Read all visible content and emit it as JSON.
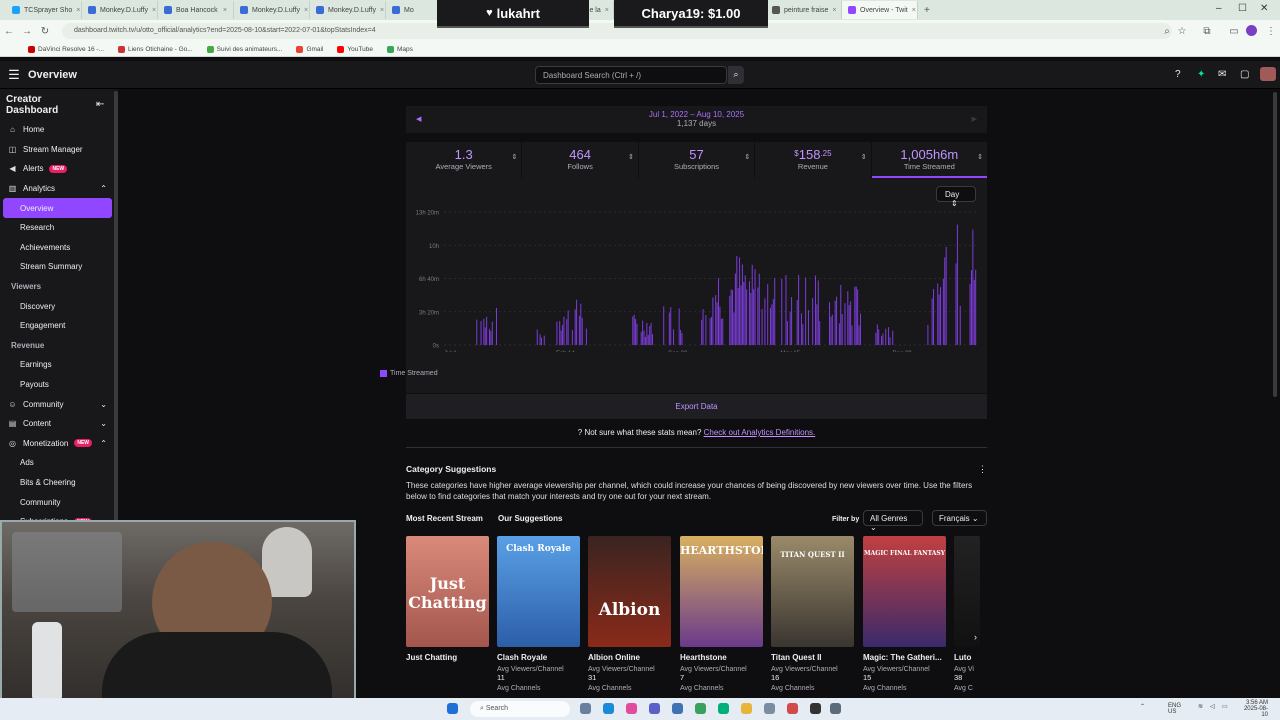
{
  "browser": {
    "tabs": [
      "TCSprayer Sho",
      "Monkey.D.Luffy",
      "Boa Hancock",
      "Monkey.D.Luffy",
      "Monkey.D.Luffy",
      "Mo",
      "Canada",
      "Customs de la",
      "Redimensionn",
      "Search Results",
      "peinture fraise",
      "Overview - Twit"
    ],
    "url": "dashboard.twitch.tv/u/otto_official/analytics?end=2025-08-10&start=2022-07-01&topStatsIndex=4",
    "bookmarks": [
      "DaVinci Resolve 16 -...",
      "Liens Otichaine - Go...",
      "Suivi des animateurs...",
      "Gmail",
      "YouTube",
      "Maps"
    ]
  },
  "overlays": {
    "left": "lukahrt",
    "right": "Charya19: $1.00"
  },
  "topnav": {
    "title": "Overview",
    "search_placeholder": "Dashboard Search (Ctrl + /)"
  },
  "sidebar": {
    "header": "Creator Dashboard",
    "items": [
      {
        "label": "Home",
        "icon": "home-icon",
        "type": "top"
      },
      {
        "label": "Stream Manager",
        "icon": "stream-manager-icon",
        "type": "top"
      },
      {
        "label": "Alerts",
        "icon": "alerts-icon",
        "type": "top",
        "badge": "NEW"
      },
      {
        "label": "Analytics",
        "icon": "analytics-icon",
        "type": "top",
        "chev": "up"
      },
      {
        "label": "Overview",
        "type": "sub",
        "active": true
      },
      {
        "label": "Research",
        "type": "sub"
      },
      {
        "label": "Achievements",
        "type": "sub"
      },
      {
        "label": "Stream Summary",
        "type": "sub"
      },
      {
        "label": "Viewers",
        "type": "cat"
      },
      {
        "label": "Discovery",
        "type": "sub"
      },
      {
        "label": "Engagement",
        "type": "sub"
      },
      {
        "label": "Revenue",
        "type": "cat"
      },
      {
        "label": "Earnings",
        "type": "sub"
      },
      {
        "label": "Payouts",
        "type": "sub"
      },
      {
        "label": "Community",
        "icon": "community-icon",
        "type": "top",
        "chev": "down"
      },
      {
        "label": "Content",
        "icon": "content-icon",
        "type": "top",
        "chev": "down"
      },
      {
        "label": "Monetization",
        "icon": "monetization-icon",
        "type": "top",
        "badge": "NEW",
        "chev": "up"
      },
      {
        "label": "Ads",
        "type": "sub"
      },
      {
        "label": "Bits & Cheering",
        "type": "sub"
      },
      {
        "label": "Community",
        "type": "sub"
      },
      {
        "label": "Subscriptions",
        "type": "sub",
        "badge": "NEW"
      }
    ]
  },
  "daterange": {
    "range": "Jul 1, 2022 – Aug 10, 2025",
    "days": "1,137 days"
  },
  "stats": [
    {
      "value": "1.3",
      "label": "Average Viewers"
    },
    {
      "value": "464",
      "label": "Follows"
    },
    {
      "value": "57",
      "label": "Subscriptions"
    },
    {
      "value_prefix": "$",
      "value": "158",
      "value_suffix": ".25",
      "label": "Revenue"
    },
    {
      "value": "1,005h6m",
      "label": "Time Streamed",
      "active": true
    }
  ],
  "chart_controls": {
    "granularity": "Day"
  },
  "chart_data": {
    "type": "bar",
    "title": "",
    "series": [
      {
        "name": "Time Streamed"
      }
    ],
    "y_ticks": [
      "13h 20m",
      "10h",
      "6h 40m",
      "3h 20m",
      "0s"
    ],
    "x_ticks": [
      "Jul 1",
      "Feb 14",
      "Sep 30",
      "May 15",
      "Dec 29"
    ],
    "ylim_hours": [
      0,
      13.33
    ],
    "bursts": [
      {
        "center": 0.08,
        "width": 0.02,
        "peak_hours": 3.8
      },
      {
        "center": 0.18,
        "width": 0.01,
        "peak_hours": 1.6
      },
      {
        "center": 0.24,
        "width": 0.03,
        "peak_hours": 4.7
      },
      {
        "center": 0.37,
        "width": 0.02,
        "peak_hours": 3.2
      },
      {
        "center": 0.43,
        "width": 0.02,
        "peak_hours": 4.2
      },
      {
        "center": 0.51,
        "width": 0.03,
        "peak_hours": 8.5
      },
      {
        "center": 0.58,
        "width": 0.04,
        "peak_hours": 9.6
      },
      {
        "center": 0.67,
        "width": 0.04,
        "peak_hours": 7.6
      },
      {
        "center": 0.75,
        "width": 0.03,
        "peak_hours": 6.2
      },
      {
        "center": 0.82,
        "width": 0.02,
        "peak_hours": 2.4
      },
      {
        "center": 0.92,
        "width": 0.02,
        "peak_hours": 6.2
      },
      {
        "center": 0.98,
        "width": 0.05,
        "peak_hours": 12.6
      }
    ],
    "grid": true,
    "legend": "bottom"
  },
  "export_label": "Export Data",
  "help": {
    "question": "Not sure what these stats mean?",
    "link": "Check out Analytics Definitions."
  },
  "category_suggestions": {
    "title": "Category Suggestions",
    "description": "These categories have higher average viewership per channel, which could increase your chances of being discovered by new viewers over time. Use the filters below to find categories that match your interests and try one out for your next stream.",
    "most_recent": "Most Recent Stream",
    "our_suggestions": "Our Suggestions",
    "filter_by": "Filter by",
    "genre": "All Genres",
    "language": "Français",
    "tiles": [
      {
        "name": "Just Chatting",
        "art": "Just Chatting",
        "avg_label": "",
        "avg": "",
        "sub": ""
      },
      {
        "name": "Clash Royale",
        "art": "Clash Royale",
        "avg_label": "Avg Viewers/Channel",
        "avg": "11",
        "sub": "Avg Channels"
      },
      {
        "name": "Albion Online",
        "art": "Albion",
        "avg_label": "Avg Viewers/Channel",
        "avg": "31",
        "sub": "Avg Channels"
      },
      {
        "name": "Hearthstone",
        "art": "HEARTHSTONE",
        "avg_label": "Avg Viewers/Channel",
        "avg": "7",
        "sub": "Avg Channels"
      },
      {
        "name": "Titan Quest II",
        "art": "TITAN QUEST II",
        "avg_label": "Avg Viewers/Channel",
        "avg": "16",
        "sub": "Avg Channels"
      },
      {
        "name": "Magic: The Gatheri...",
        "art": "MAGIC FINAL FANTASY",
        "avg_label": "Avg Viewers/Channel",
        "avg": "15",
        "sub": "Avg Channels"
      },
      {
        "name": "Luto",
        "art": "",
        "avg_label": "Avg Vi",
        "avg": "38",
        "sub": "Avg C"
      }
    ]
  },
  "taskbar": {
    "search": "Search",
    "lang": "ENG US",
    "time": "3:56 AM",
    "date": "2025-08-10"
  }
}
